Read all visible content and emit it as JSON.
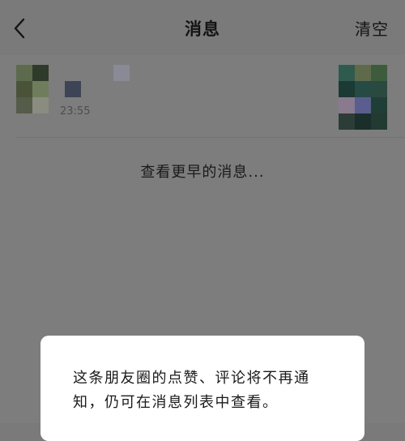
{
  "header": {
    "title": "消息",
    "clear_label": "清空"
  },
  "message": {
    "time": "23:55"
  },
  "more_link": "查看更早的消息...",
  "dialog": {
    "text": "这条朋友圈的点赞、评论将不再通知，仍可在消息列表中查看。"
  },
  "colors": {
    "overlay_background": "#7d7d7d",
    "dialog_background": "#ffffff",
    "text_primary": "#141414",
    "text_secondary": "#4e4e4e"
  },
  "icons": {
    "back": "chevron-left-icon"
  }
}
